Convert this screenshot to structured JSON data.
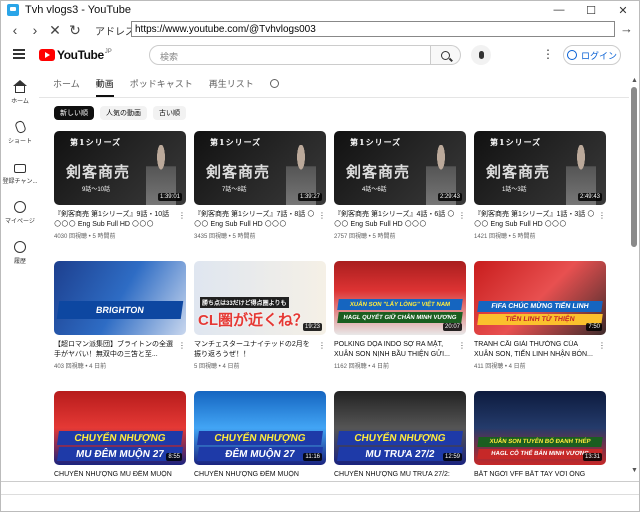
{
  "window": {
    "title": "Tvh vlogs3 - YouTube"
  },
  "nav": {
    "address_label": "アドレス(D)",
    "url": "https://www.youtube.com/@Tvhvlogs003"
  },
  "header": {
    "logo_text": "YouTube",
    "logo_sup": "JP",
    "search_placeholder": "検索",
    "login_label": "ログイン"
  },
  "sidebar": {
    "items": [
      {
        "label": "ホーム",
        "icon": "home-icon"
      },
      {
        "label": "ショート",
        "icon": "shorts-icon"
      },
      {
        "label": "登録チャン...",
        "icon": "subscriptions-icon"
      },
      {
        "label": "マイページ",
        "icon": "my-page-icon"
      },
      {
        "label": "履歴",
        "icon": "history-icon"
      }
    ]
  },
  "tabs": [
    "ホーム",
    "動画",
    "ポッドキャスト",
    "再生リスト"
  ],
  "active_tab": "動画",
  "chips": [
    "新しい順",
    "人気の動画",
    "古い順"
  ],
  "videos": [
    {
      "title": "『剣客商売 第1シリーズ』9話・10話 🌕🌕🌕 Eng Sub Full HD 🌕🌕🌕",
      "meta": "4030 回視聴 • 5 時間前",
      "duration": "1:39:01",
      "thumb_line1": "第1シリーズ",
      "thumb_line2": "剣客商売",
      "thumb_line3": "9話〜10話"
    },
    {
      "title": "『剣客商売 第1シリーズ』7話・8話 🌕🌕🌕 Eng Sub Full HD 🌕🌕🌕",
      "meta": "3435 回視聴 • 5 時間前",
      "duration": "1:39:27",
      "thumb_line1": "第1シリーズ",
      "thumb_line2": "剣客商売",
      "thumb_line3": "7話〜8話"
    },
    {
      "title": "『剣客商売 第1シリーズ』4話・6話 🌕🌕🌕 Eng Sub Full HD 🌕🌕🌕",
      "meta": "2757 回視聴 • 5 時間前",
      "duration": "2:29:43",
      "thumb_line1": "第1シリーズ",
      "thumb_line2": "剣客商売",
      "thumb_line3": "4話〜6話"
    },
    {
      "title": "『剣客商売 第1シリーズ』1話・3話 🌕🌕🌕 Eng Sub Full HD 🌕🌕🌕",
      "meta": "1421 回視聴 • 5 時間前",
      "duration": "2:49:43",
      "thumb_line1": "第1シリーズ",
      "thumb_line2": "剣客商売",
      "thumb_line3": "1話〜3話"
    },
    {
      "title": "【超ロマン派集団】ブライトンの全選手がヤバい！無双中の三笘と至...",
      "meta": "403 回視聴 • 4 日前",
      "duration": "",
      "thumb_line1": "BRIGHTON",
      "thumb_line2": "",
      "thumb_line3": ""
    },
    {
      "title": "マンチェスターユナイテッドの2月を振り返ろうぜ！！",
      "meta": "5 回視聴 • 4 日前",
      "duration": "19:23",
      "thumb_line1": "勝ち点は33だけど得点圏よりも",
      "thumb_line2": "CL圏が近くね？",
      "thumb_line3": ""
    },
    {
      "title": "POLKING DỌA INDO SỢ RA MẶT, XUÂN SON NỊNH BẦU THIỆN GỬI...",
      "meta": "1162 回視聴 • 4 日前",
      "duration": "20:07",
      "thumb_line1": "XUÂN SON \"LẤY LÒNG\" VIỆT NAM",
      "thumb_line2": "HAGL QUYẾT GIỮ CHÂN MINH VƯƠNG",
      "thumb_line3": ""
    },
    {
      "title": "TRANH CÃI GIẢI THƯỞNG CỦA XUÂN SON, TIẾN LINH NHẬN BÓN...",
      "meta": "411 回視聴 • 4 日前",
      "duration": "7:50",
      "thumb_line1": "FIFA CHÚC MỪNG TIẾN LINH",
      "thumb_line2": "TIẾN LINH TỪ THIỆN",
      "thumb_line3": ""
    },
    {
      "title": "CHUYỂN NHƯỢNG MU ĐÊM MUỘN",
      "meta": "",
      "duration": "8:55",
      "thumb_line1": "CHUYỂN NHƯỢNG",
      "thumb_line2": "MU ĐÊM MUỘN 27",
      "thumb_line3": ""
    },
    {
      "title": "CHUYỂN NHƯỢNG ĐÊM MUỘN",
      "meta": "",
      "duration": "11:16",
      "thumb_line1": "CHUYỂN NHƯỢNG",
      "thumb_line2": "ĐÊM MUỘN 27",
      "thumb_line3": ""
    },
    {
      "title": "CHUYỂN NHƯỢNG MU TRƯA 27/2:",
      "meta": "",
      "duration": "12:59",
      "thumb_line1": "CHUYỂN NHƯỢNG",
      "thumb_line2": "MU TRƯA 27/2",
      "thumb_line3": ""
    },
    {
      "title": "BẮT NGỜI VFF BẮT TAY VỚI ÔNG",
      "meta": "",
      "duration": "13:31",
      "thumb_line1": "XUÂN SON TUYÊN BỐ ĐANH THÉP",
      "thumb_line2": "HAGL CÔ THỂ BÁN MINH VƯƠNG",
      "thumb_line3": ""
    }
  ],
  "colors": {
    "accent": "#ff0000",
    "link": "#065fd4",
    "banner_blue": "#1e3aa8",
    "banner_yellow": "#ffeb3b"
  }
}
